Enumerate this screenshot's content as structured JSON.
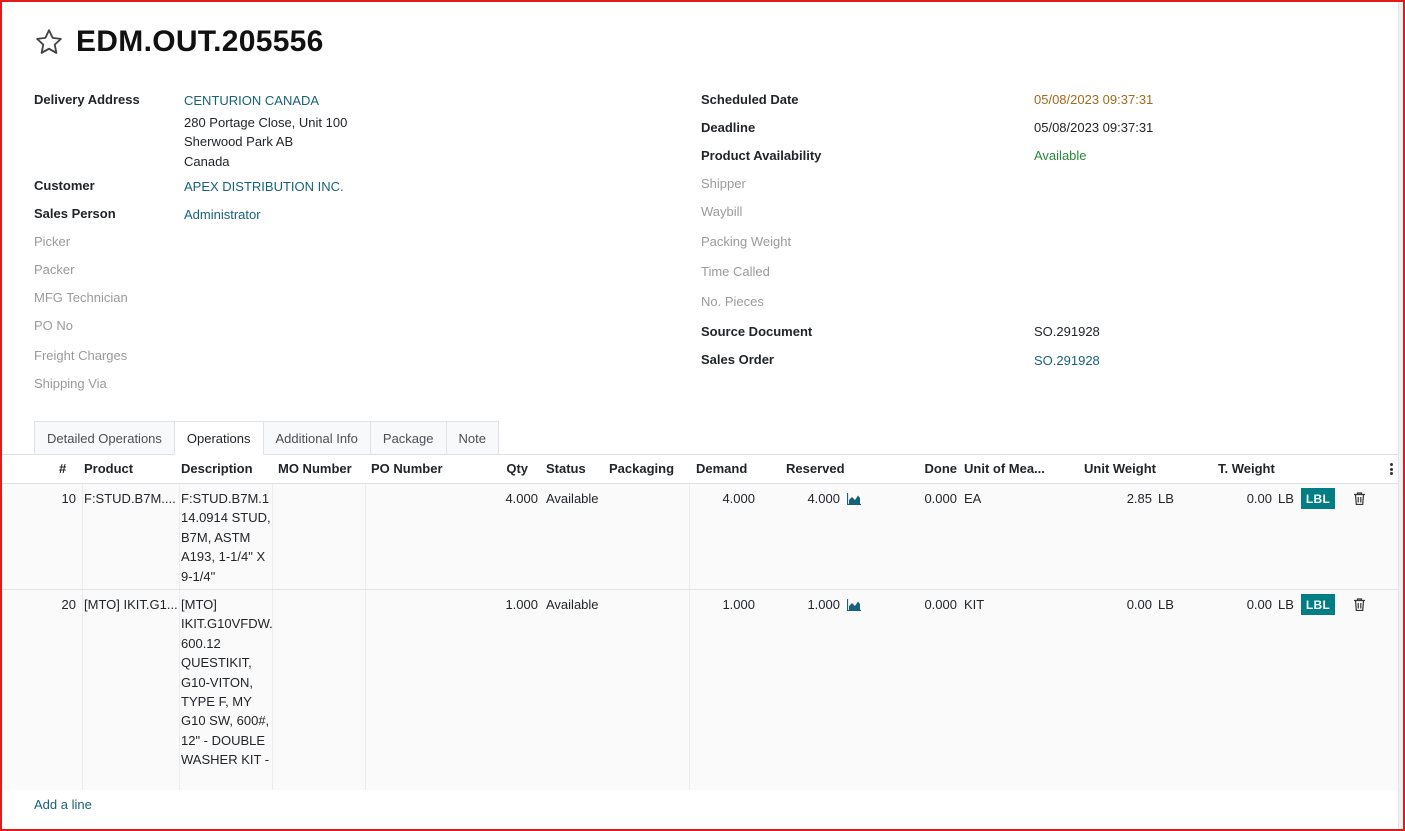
{
  "record": {
    "title": "EDM.OUT.205556"
  },
  "left_fields": {
    "delivery_address": {
      "label": "Delivery Address",
      "name": "CENTURION CANADA",
      "lines": [
        "280 Portage Close, Unit 100",
        "Sherwood Park AB",
        "Canada"
      ]
    },
    "customer": {
      "label": "Customer",
      "value": "APEX DISTRIBUTION INC."
    },
    "sales_person": {
      "label": "Sales Person",
      "value": "Administrator"
    },
    "picker": {
      "label": "Picker"
    },
    "packer": {
      "label": "Packer"
    },
    "mfg_technician": {
      "label": "MFG Technician"
    },
    "po_no": {
      "label": "PO No"
    },
    "freight_charges": {
      "label": "Freight Charges"
    },
    "shipping_via": {
      "label": "Shipping Via"
    }
  },
  "right_fields": {
    "scheduled_date": {
      "label": "Scheduled Date",
      "value": "05/08/2023 09:37:31"
    },
    "deadline": {
      "label": "Deadline",
      "value": "05/08/2023 09:37:31"
    },
    "product_availability": {
      "label": "Product Availability",
      "value": "Available"
    },
    "shipper": {
      "label": "Shipper"
    },
    "waybill": {
      "label": "Waybill"
    },
    "packing_weight": {
      "label": "Packing Weight"
    },
    "time_called": {
      "label": "Time Called"
    },
    "no_pieces": {
      "label": "No. Pieces"
    },
    "source_document": {
      "label": "Source Document",
      "value": "SO.291928"
    },
    "sales_order": {
      "label": "Sales Order",
      "value": "SO.291928"
    }
  },
  "tabs": [
    {
      "label": "Detailed Operations",
      "active": false
    },
    {
      "label": "Operations",
      "active": true
    },
    {
      "label": "Additional Info",
      "active": false
    },
    {
      "label": "Package",
      "active": false
    },
    {
      "label": "Note",
      "active": false
    }
  ],
  "table": {
    "columns": {
      "seq": "#",
      "product": "Product",
      "description": "Description",
      "mo_number": "MO Number",
      "po_number": "PO Number",
      "qty": "Qty",
      "status": "Status",
      "packaging": "Packaging",
      "demand": "Demand",
      "reserved": "Reserved",
      "done": "Done",
      "uom": "Unit of Mea...",
      "unit_weight": "Unit Weight",
      "total_weight": "T. Weight"
    },
    "rows": [
      {
        "seq": "10",
        "product": "F:STUD.B7M....",
        "description": "F:STUD.B7M.1 14.0914 STUD, B7M, ASTM A193, 1-1/4\" X 9-1/4\"",
        "qty": "4.000",
        "status": "Available",
        "demand": "4.000",
        "reserved": "4.000",
        "done": "0.000",
        "uom": "EA",
        "unit_weight": "2.85",
        "unit_weight_uom": "LB",
        "total_weight": "0.00",
        "total_weight_uom": "LB",
        "label_button": "LBL"
      },
      {
        "seq": "20",
        "product": "[MTO] IKIT.G1...",
        "description": "[MTO] IKIT.G10VFDW. 600.12 QUESTIKIT, G10-VITON, TYPE F, MY G10 SW, 600#, 12\" - DOUBLE WASHER KIT -",
        "qty": "1.000",
        "status": "Available",
        "demand": "1.000",
        "reserved": "1.000",
        "done": "0.000",
        "uom": "KIT",
        "unit_weight": "0.00",
        "unit_weight_uom": "LB",
        "total_weight": "0.00",
        "total_weight_uom": "LB",
        "label_button": "LBL"
      }
    ],
    "add_line": "Add a line"
  },
  "colors": {
    "link": "#17627a",
    "warning_date": "#a36a1d",
    "available": "#28893b",
    "label_button": "#017e84",
    "frame": "#e01b1b"
  }
}
